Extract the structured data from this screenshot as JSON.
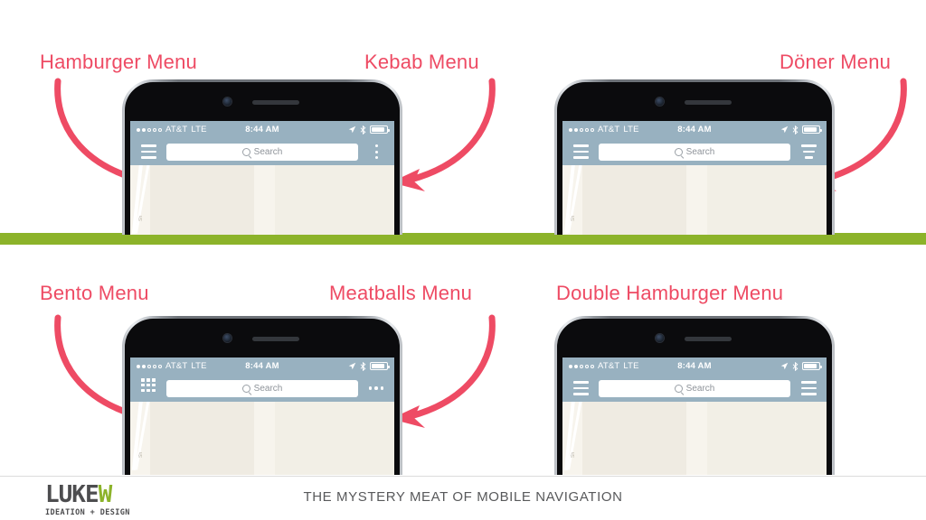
{
  "slide": {
    "footer_title": "THE MYSTERY MEAT OF MOBILE NAVIGATION",
    "accent_red": "#EE4B64",
    "accent_green": "#8CB32A",
    "navbar_blue": "#98B1C0"
  },
  "logo": {
    "main_left": "LUKE",
    "main_right": "W",
    "subtitle": "IDEATION + DESIGN"
  },
  "status_bar": {
    "carrier": "AT&T",
    "network": "LTE",
    "time": "8:44 AM",
    "signal_filled": 2,
    "signal_empty": 3,
    "location_icon": "location-arrow-icon",
    "bluetooth_icon": "bluetooth-icon",
    "battery_icon": "battery-icon"
  },
  "search": {
    "placeholder": "Search",
    "icon": "search-icon"
  },
  "callouts": [
    {
      "label": "Hamburger Menu",
      "id": "hamburger"
    },
    {
      "label": "Kebab Menu",
      "id": "kebab"
    },
    {
      "label": "Döner Menu",
      "id": "doner"
    },
    {
      "label": "Bento Menu",
      "id": "bento"
    },
    {
      "label": "Meatballs Menu",
      "id": "meatballs"
    },
    {
      "label": "Double Hamburger Menu",
      "id": "double-hamburger"
    }
  ],
  "phones": [
    {
      "left_icon": "hamburger-menu-icon",
      "right_icon": "kebab-menu-icon"
    },
    {
      "left_icon": "hamburger-menu-icon",
      "right_icon": "doner-menu-icon"
    },
    {
      "left_icon": "bento-menu-icon",
      "right_icon": "meatballs-menu-icon"
    },
    {
      "left_icon": "hamburger-menu-icon",
      "right_icon": "hamburger-menu-icon"
    }
  ]
}
